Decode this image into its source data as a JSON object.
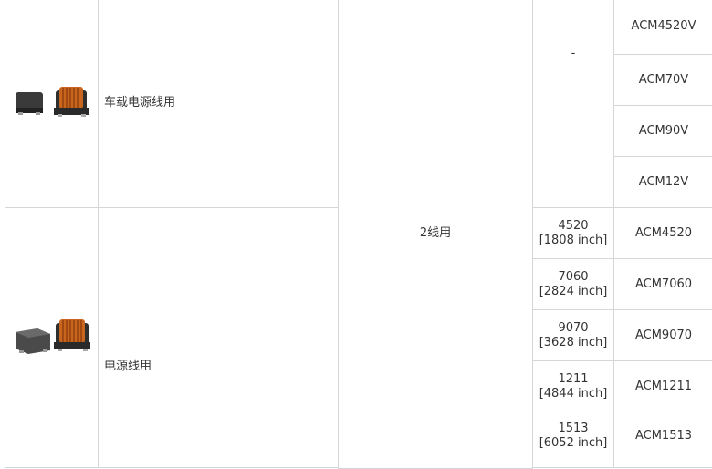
{
  "rows": [
    {
      "usage": "车载电源线用",
      "image_icon": "common-mode-choke-automotive-image",
      "size_text": "-",
      "models": [
        "ACM4520V",
        "ACM70V",
        "ACM90V",
        "ACM12V"
      ]
    },
    {
      "usage": "电源线用",
      "image_icon": "common-mode-choke-power-image",
      "sizes": [
        {
          "code": "4520",
          "inch": "[1808 inch]",
          "model": "ACM4520"
        },
        {
          "code": "7060",
          "inch": "[2824 inch]",
          "model": "ACM7060"
        },
        {
          "code": "9070",
          "inch": "[3628 inch]",
          "model": "ACM9070"
        },
        {
          "code": "1211",
          "inch": "[4844 inch]",
          "model": "ACM1211"
        },
        {
          "code": "1513",
          "inch": "[6052 inch]",
          "model": "ACM1513"
        }
      ]
    }
  ],
  "shared": {
    "line_count": "2线用"
  },
  "colors": {
    "border": "#d6d6d6",
    "text": "#333333",
    "copper": "#c8651f"
  }
}
